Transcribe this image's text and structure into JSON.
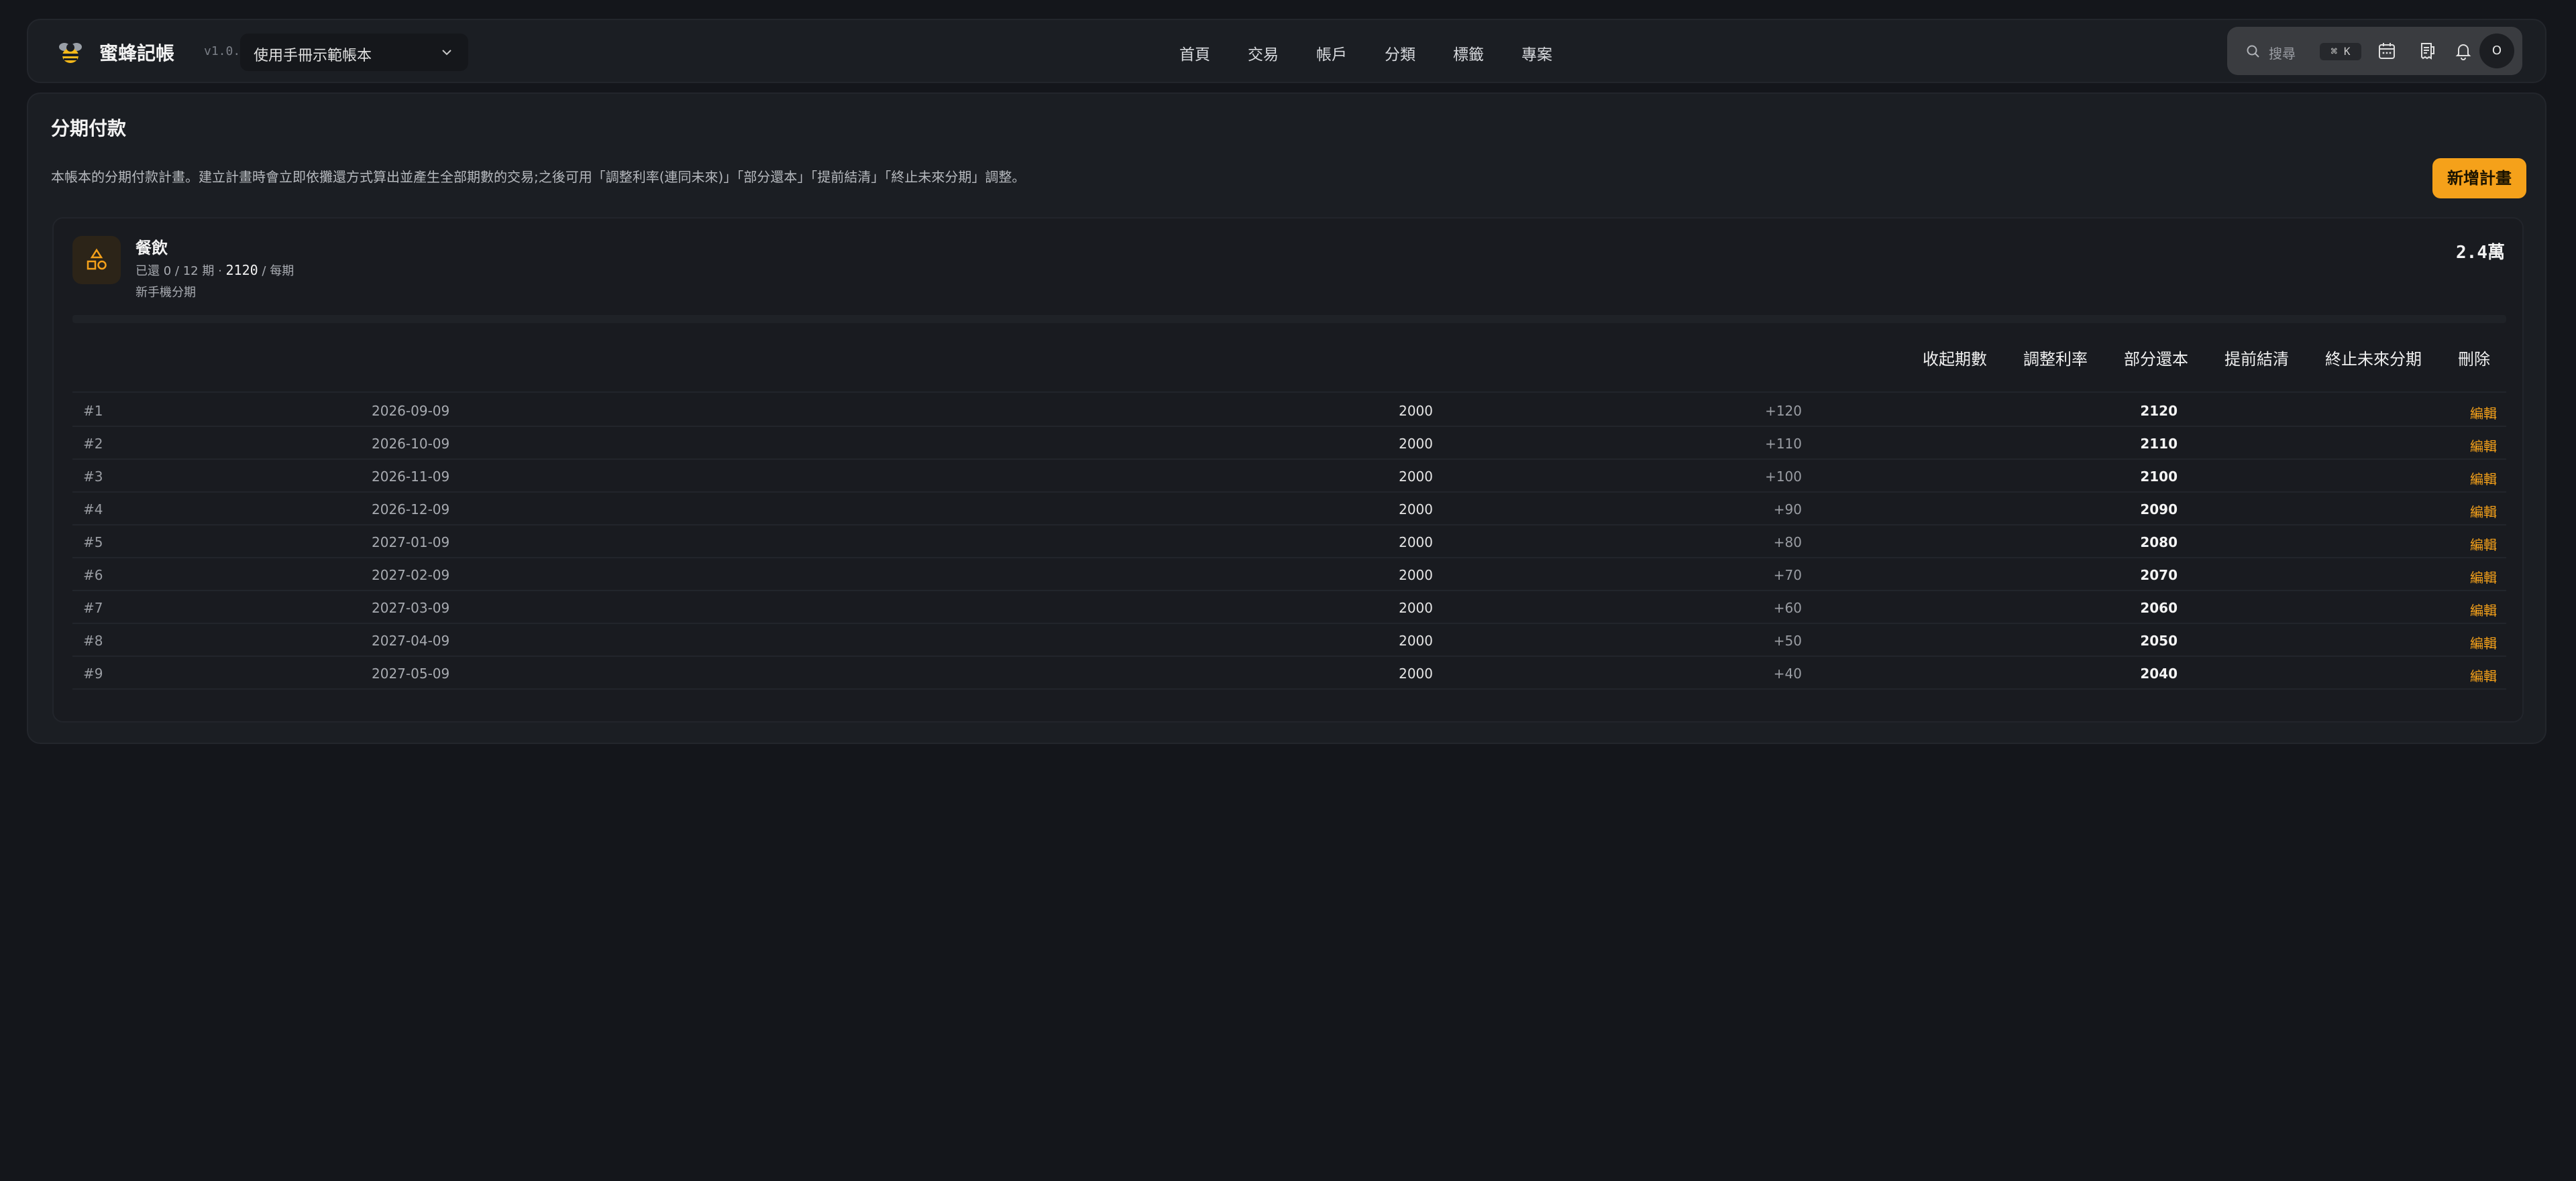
{
  "header": {
    "title": "蜜蜂記帳",
    "version": "v1.0.0",
    "book_select": "使用手冊示範帳本",
    "nav": [
      "首頁",
      "交易",
      "帳戶",
      "分類",
      "標籤",
      "專案"
    ],
    "search_label": "搜尋",
    "search_shortcut": "⌘ K",
    "avatar_initial": "O"
  },
  "page": {
    "title": "分期付款",
    "description": "本帳本的分期付款計畫。建立計畫時會立即依攤還方式算出並產生全部期數的交易;之後可用「調整利率(連同未來)」「部分還本」「提前結清」「終止未來分期」調整。",
    "add_button": "新增計畫"
  },
  "plan": {
    "category": "餐飲",
    "paid_label": "已還",
    "paid": "0",
    "total_periods": "12",
    "period_unit": "期",
    "per_period_amount": "2120",
    "per_period_label": "/ 每期",
    "note": "新手機分期",
    "total": "2.4萬",
    "actions": [
      "收起期數",
      "調整利率",
      "部分還本",
      "提前結清",
      "終止未來分期",
      "刪除"
    ],
    "schedule": [
      {
        "no": "#1",
        "date": "2026-09-09",
        "principal": "2000",
        "interest": "+120",
        "total": "2120",
        "edit": "編輯"
      },
      {
        "no": "#2",
        "date": "2026-10-09",
        "principal": "2000",
        "interest": "+110",
        "total": "2110",
        "edit": "編輯"
      },
      {
        "no": "#3",
        "date": "2026-11-09",
        "principal": "2000",
        "interest": "+100",
        "total": "2100",
        "edit": "編輯"
      },
      {
        "no": "#4",
        "date": "2026-12-09",
        "principal": "2000",
        "interest": "+90",
        "total": "2090",
        "edit": "編輯"
      },
      {
        "no": "#5",
        "date": "2027-01-09",
        "principal": "2000",
        "interest": "+80",
        "total": "2080",
        "edit": "編輯"
      },
      {
        "no": "#6",
        "date": "2027-02-09",
        "principal": "2000",
        "interest": "+70",
        "total": "2070",
        "edit": "編輯"
      },
      {
        "no": "#7",
        "date": "2027-03-09",
        "principal": "2000",
        "interest": "+60",
        "total": "2060",
        "edit": "編輯"
      },
      {
        "no": "#8",
        "date": "2027-04-09",
        "principal": "2000",
        "interest": "+50",
        "total": "2050",
        "edit": "編輯"
      },
      {
        "no": "#9",
        "date": "2027-05-09",
        "principal": "2000",
        "interest": "+40",
        "total": "2040",
        "edit": "編輯"
      }
    ]
  },
  "colors": {
    "accent": "#f5a11a",
    "background": "#14161b",
    "panel": "#1b1e23"
  },
  "icons": [
    "bee-logo-icon",
    "chevron-down-icon",
    "search-icon",
    "calendar-icon",
    "receipt-icon",
    "bell-icon",
    "shapes-category-icon"
  ]
}
